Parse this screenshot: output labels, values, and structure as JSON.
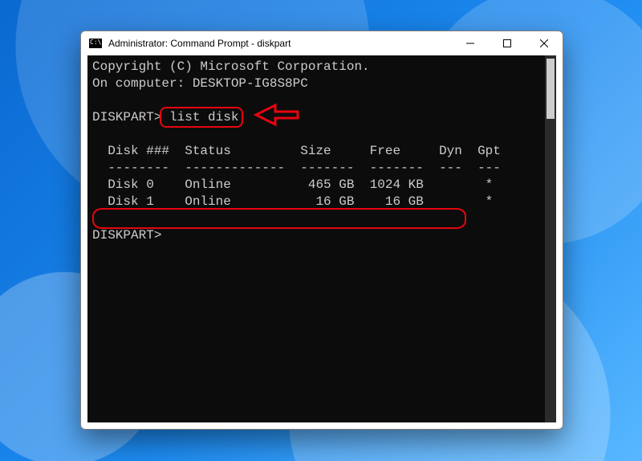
{
  "window": {
    "title": "Administrator: Command Prompt - diskpart"
  },
  "terminal": {
    "line1": "Copyright (C) Microsoft Corporation.",
    "line2": "On computer: DESKTOP-IG8S8PC",
    "blank1": "",
    "prompt1_prefix": "DISKPART> ",
    "prompt1_cmd": "list disk",
    "blank2": "",
    "header": "  Disk ###  Status         Size     Free     Dyn  Gpt",
    "divider": "  --------  -------------  -------  -------  ---  ---",
    "row0": "  Disk 0    Online          465 GB  1024 KB        *",
    "row1": "  Disk 1    Online           16 GB    16 GB        *",
    "blank3": "",
    "prompt2": "DISKPART>"
  },
  "annotations": {
    "highlight_command": "list disk",
    "highlight_row": "Disk 1",
    "arrow_color": "#e7040f"
  }
}
